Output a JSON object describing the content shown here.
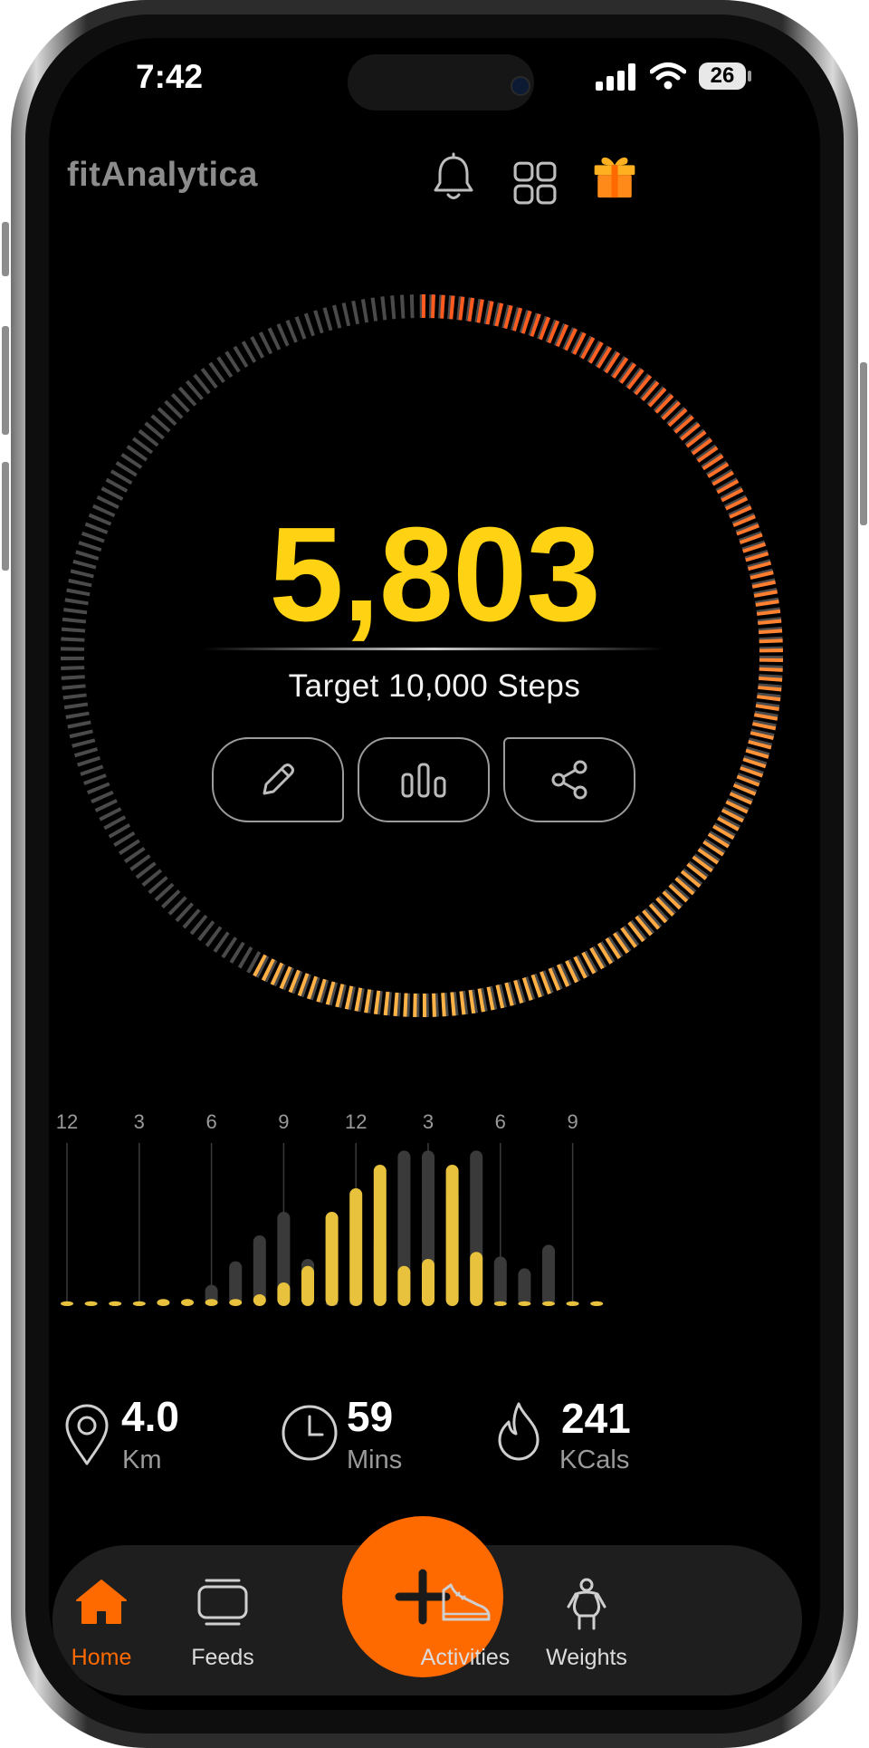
{
  "status_bar": {
    "time": "7:42",
    "battery": "26"
  },
  "header": {
    "app_title": "fitAnalytica"
  },
  "steps": {
    "count": "5,803",
    "target_label": "Target 10,000 Steps",
    "progress": 0.58
  },
  "hourly_chart": {
    "hour_labels": [
      "12",
      "3",
      "6",
      "9",
      "12",
      "3",
      "6",
      "9"
    ]
  },
  "chart_data": {
    "type": "bar",
    "x_tick_labels": [
      "12",
      "3",
      "6",
      "9",
      "12",
      "3",
      "6",
      "9"
    ],
    "series": [
      {
        "values": [
          0.02,
          0.02,
          0.02,
          0.02,
          0.02,
          0.03,
          0.09,
          0.19,
          0.3,
          0.4,
          0.2,
          0.02,
          0.03,
          0.3,
          0.66,
          0.66,
          0.5,
          0.66,
          0.21,
          0.16,
          0.26,
          0.02,
          0.02
        ]
      },
      {
        "values": [
          0.02,
          0.02,
          0.02,
          0.02,
          0.03,
          0.03,
          0.03,
          0.03,
          0.05,
          0.1,
          0.17,
          0.4,
          0.5,
          0.6,
          0.17,
          0.2,
          0.6,
          0.23,
          0.02,
          0.02,
          0.02,
          0.02,
          0.02
        ]
      }
    ],
    "colors": {
      "series_0": "#3a3a3a",
      "series_1": "#e8c23c"
    }
  },
  "stats": [
    {
      "icon": "location-pin-icon",
      "value": "4.0",
      "unit": "Km"
    },
    {
      "icon": "clock-icon",
      "value": "59",
      "unit": "Mins"
    },
    {
      "icon": "flame-icon",
      "value": "241",
      "unit": "KCals"
    }
  ],
  "tabs": [
    {
      "icon": "home-icon",
      "label": "Home",
      "active": true
    },
    {
      "icon": "feeds-icon",
      "label": "Feeds",
      "active": false
    },
    {
      "icon": "sneaker-icon",
      "label": "Activities",
      "active": false
    },
    {
      "icon": "body-weight-icon",
      "label": "Weights",
      "active": false
    }
  ],
  "colors": {
    "accent": "#ff6a00",
    "steps": "#ffd313",
    "ring_start": "#ff5a1f",
    "ring_end": "#ffb347",
    "ring_track": "#4a4a4a"
  }
}
